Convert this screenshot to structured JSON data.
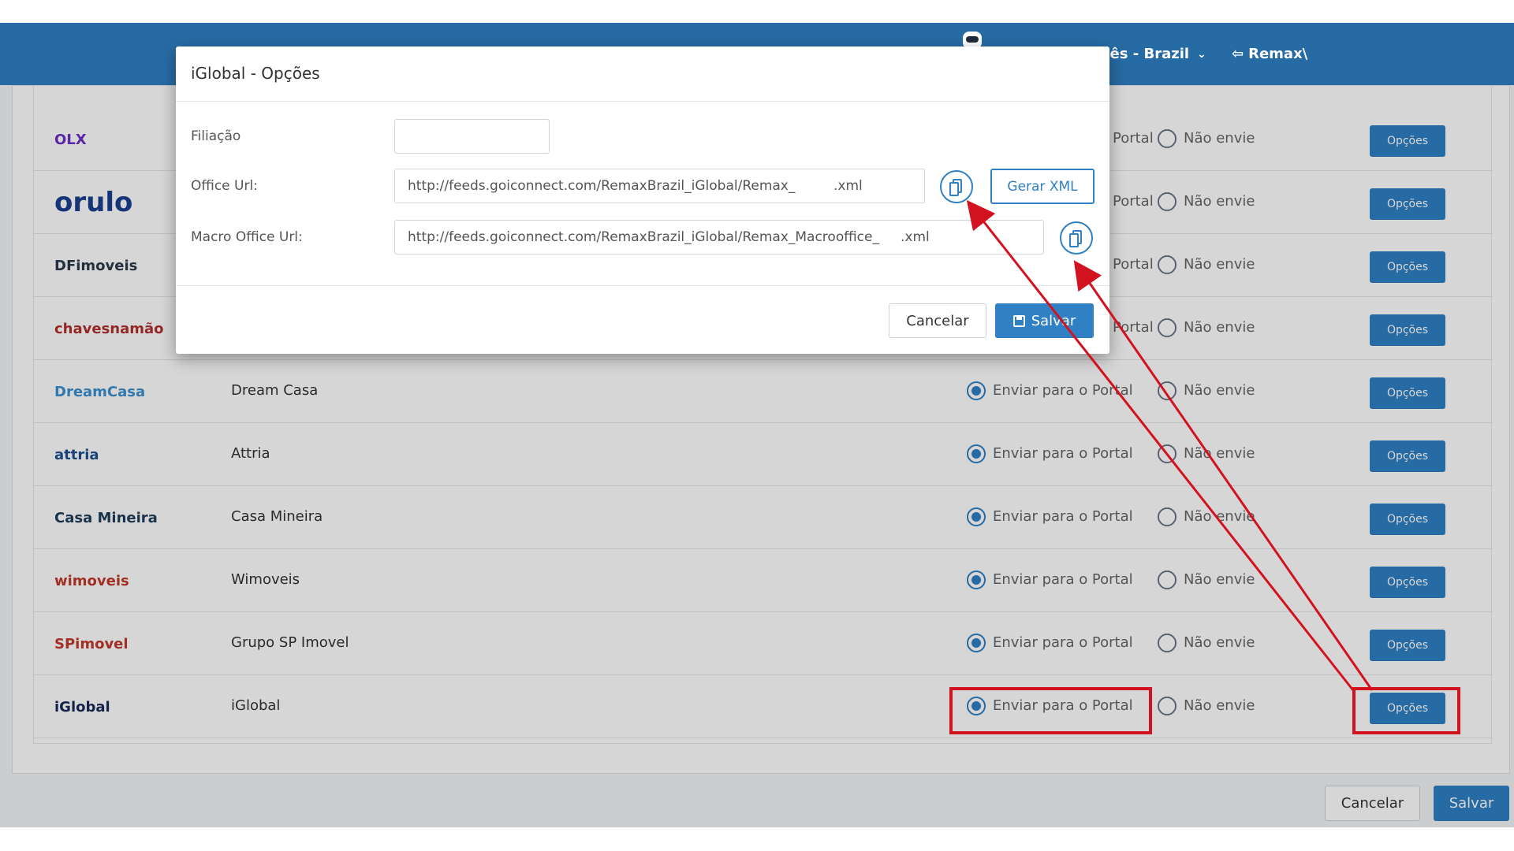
{
  "header": {
    "language_label": "Português - Brazil",
    "user_label": "Remax\\"
  },
  "portals": [
    {
      "name": "",
      "logo_text": "OLX",
      "logo_color": "#6b2fc8"
    },
    {
      "name": "",
      "logo_text": "orulo",
      "logo_color": "#1b3f8f"
    },
    {
      "name": "",
      "logo_text": "DFimoveis",
      "logo_color": "#2b3a4a"
    },
    {
      "name": "",
      "logo_text": "chavesnamão",
      "logo_color": "#b0322f"
    },
    {
      "name": "Dream Casa",
      "logo_text": "DreamCasa",
      "logo_color": "#3a8fcf"
    },
    {
      "name": "Attria",
      "logo_text": "attria",
      "logo_color": "#1d4e8f"
    },
    {
      "name": "Casa Mineira",
      "logo_text": "Casa Mineira",
      "logo_color": "#1e3d5a"
    },
    {
      "name": "Wimoveis",
      "logo_text": "wimoveis",
      "logo_color": "#c0392b"
    },
    {
      "name": "Grupo SP Imovel",
      "logo_text": "SPimovel",
      "logo_color": "#c0392b"
    },
    {
      "name": "iGlobal",
      "logo_text": "iGlobal",
      "logo_color": "#1a2a5a"
    }
  ],
  "options": {
    "send_label": "Enviar para o Portal",
    "send_label_short": "Portal",
    "dont_send_label": "Não envie",
    "options_button": "Opções"
  },
  "footer": {
    "cancel": "Cancelar",
    "save": "Salvar"
  },
  "modal": {
    "title": "iGlobal - Opções",
    "filiacao_label": "Filiação",
    "filiacao_value": "",
    "office_label": "Office Url:",
    "office_value": "http://feeds.goiconnect.com/RemaxBrazil_iGlobal/Remax_         .xml",
    "macro_label": "Macro Office Url:",
    "macro_value": "http://feeds.goiconnect.com/RemaxBrazil_iGlobal/Remax_Macrooffice_     .xml",
    "gerar_xml": "Gerar XML",
    "cancel": "Cancelar",
    "save": "Salvar"
  },
  "colors": {
    "primary": "#2f80c4",
    "highlight": "#d3121f"
  }
}
